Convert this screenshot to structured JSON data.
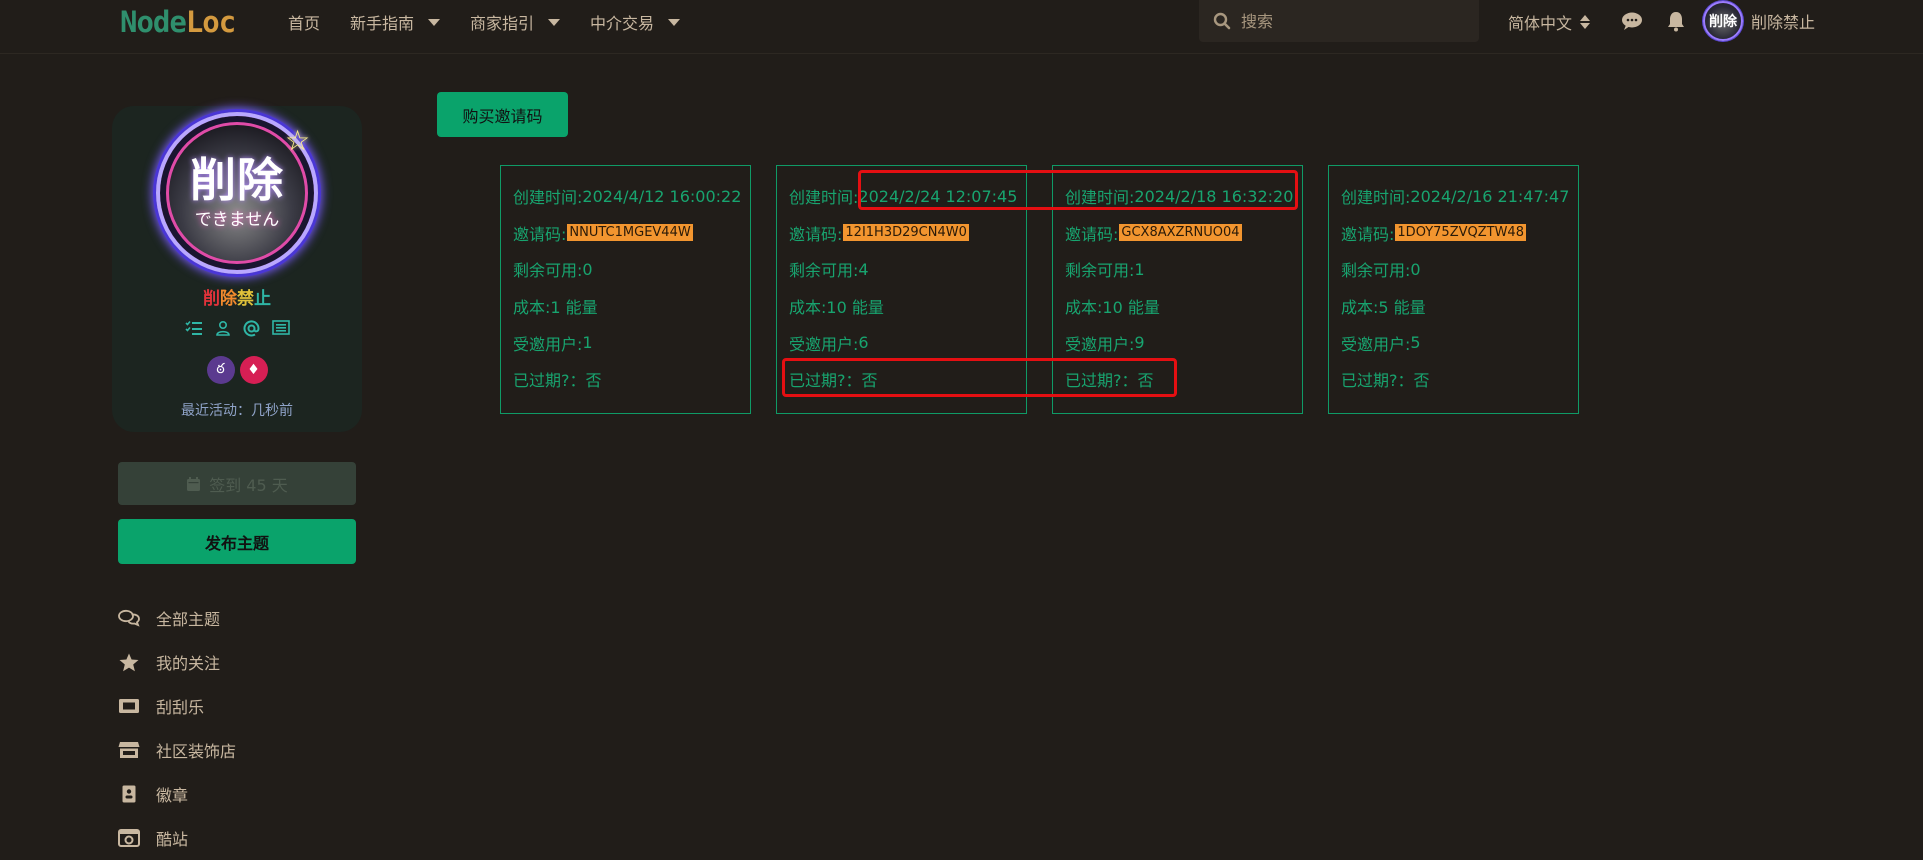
{
  "header": {
    "logo_part1": "Node",
    "logo_part2": "Loc",
    "nav": [
      {
        "label": "首页",
        "has_dropdown": false
      },
      {
        "label": "新手指南",
        "has_dropdown": true
      },
      {
        "label": "商家指引",
        "has_dropdown": true
      },
      {
        "label": "中介交易",
        "has_dropdown": true
      }
    ],
    "search_placeholder": "搜索",
    "language": "简体中文",
    "icons": [
      "search-icon",
      "chat-icon",
      "bell-icon"
    ],
    "avatar_text": "削除",
    "username": "削除禁止"
  },
  "profile": {
    "avatar_main": "削除",
    "avatar_sub": "できません",
    "name_chars": [
      "削",
      "除",
      "禁",
      "止"
    ],
    "icons": [
      "list-check-icon",
      "user-icon",
      "at-icon",
      "article-icon"
    ],
    "badges": [
      "medal-badge",
      "gem-badge"
    ],
    "last_active": "最近活动：几秒前"
  },
  "sidebar": {
    "checkin_label": "签到 45 天",
    "publish_label": "发布主题",
    "items": [
      {
        "label": "全部主题",
        "icon": "comments-icon"
      },
      {
        "label": "我的关注",
        "icon": "star-icon"
      },
      {
        "label": "刮刮乐",
        "icon": "ticket-icon"
      },
      {
        "label": "社区装饰店",
        "icon": "store-icon"
      },
      {
        "label": "徽章",
        "icon": "badge-icon"
      },
      {
        "label": "酷站",
        "icon": "camera-icon"
      }
    ]
  },
  "main": {
    "buy_button": "购买邀请码",
    "label_created": "创建时间: ",
    "label_code": "邀请码: ",
    "label_remaining": "剩余可用: ",
    "label_cost": "成本: ",
    "label_invited": "受邀用户: ",
    "label_expired": "已过期?：",
    "cards": [
      {
        "created": "2024/4/12 16:00:22",
        "code": "NNUTC1MGEV44W",
        "remaining": "0",
        "cost": "1 能量",
        "invited": "1",
        "expired": "否"
      },
      {
        "created": "2024/2/24 12:07:45",
        "code": "12I1H3D29CN4W0",
        "remaining": "4",
        "cost": "10 能量",
        "invited": "6",
        "expired": "否"
      },
      {
        "created": "2024/2/18 16:32:20",
        "code": "GCX8AXZRNUO04",
        "remaining": "1",
        "cost": "10 能量",
        "invited": "9",
        "expired": "否"
      },
      {
        "created": "2024/2/16 21:47:47",
        "code": "1DOY75ZVQZTW48",
        "remaining": "0",
        "cost": "5 能量",
        "invited": "5",
        "expired": "否"
      }
    ]
  },
  "colors": {
    "background": "#211d19",
    "accent_green": "#0aa36b",
    "card_text": "#18a46f",
    "code_highlight": "#f2952f",
    "annotation_red": "#e50f12"
  }
}
